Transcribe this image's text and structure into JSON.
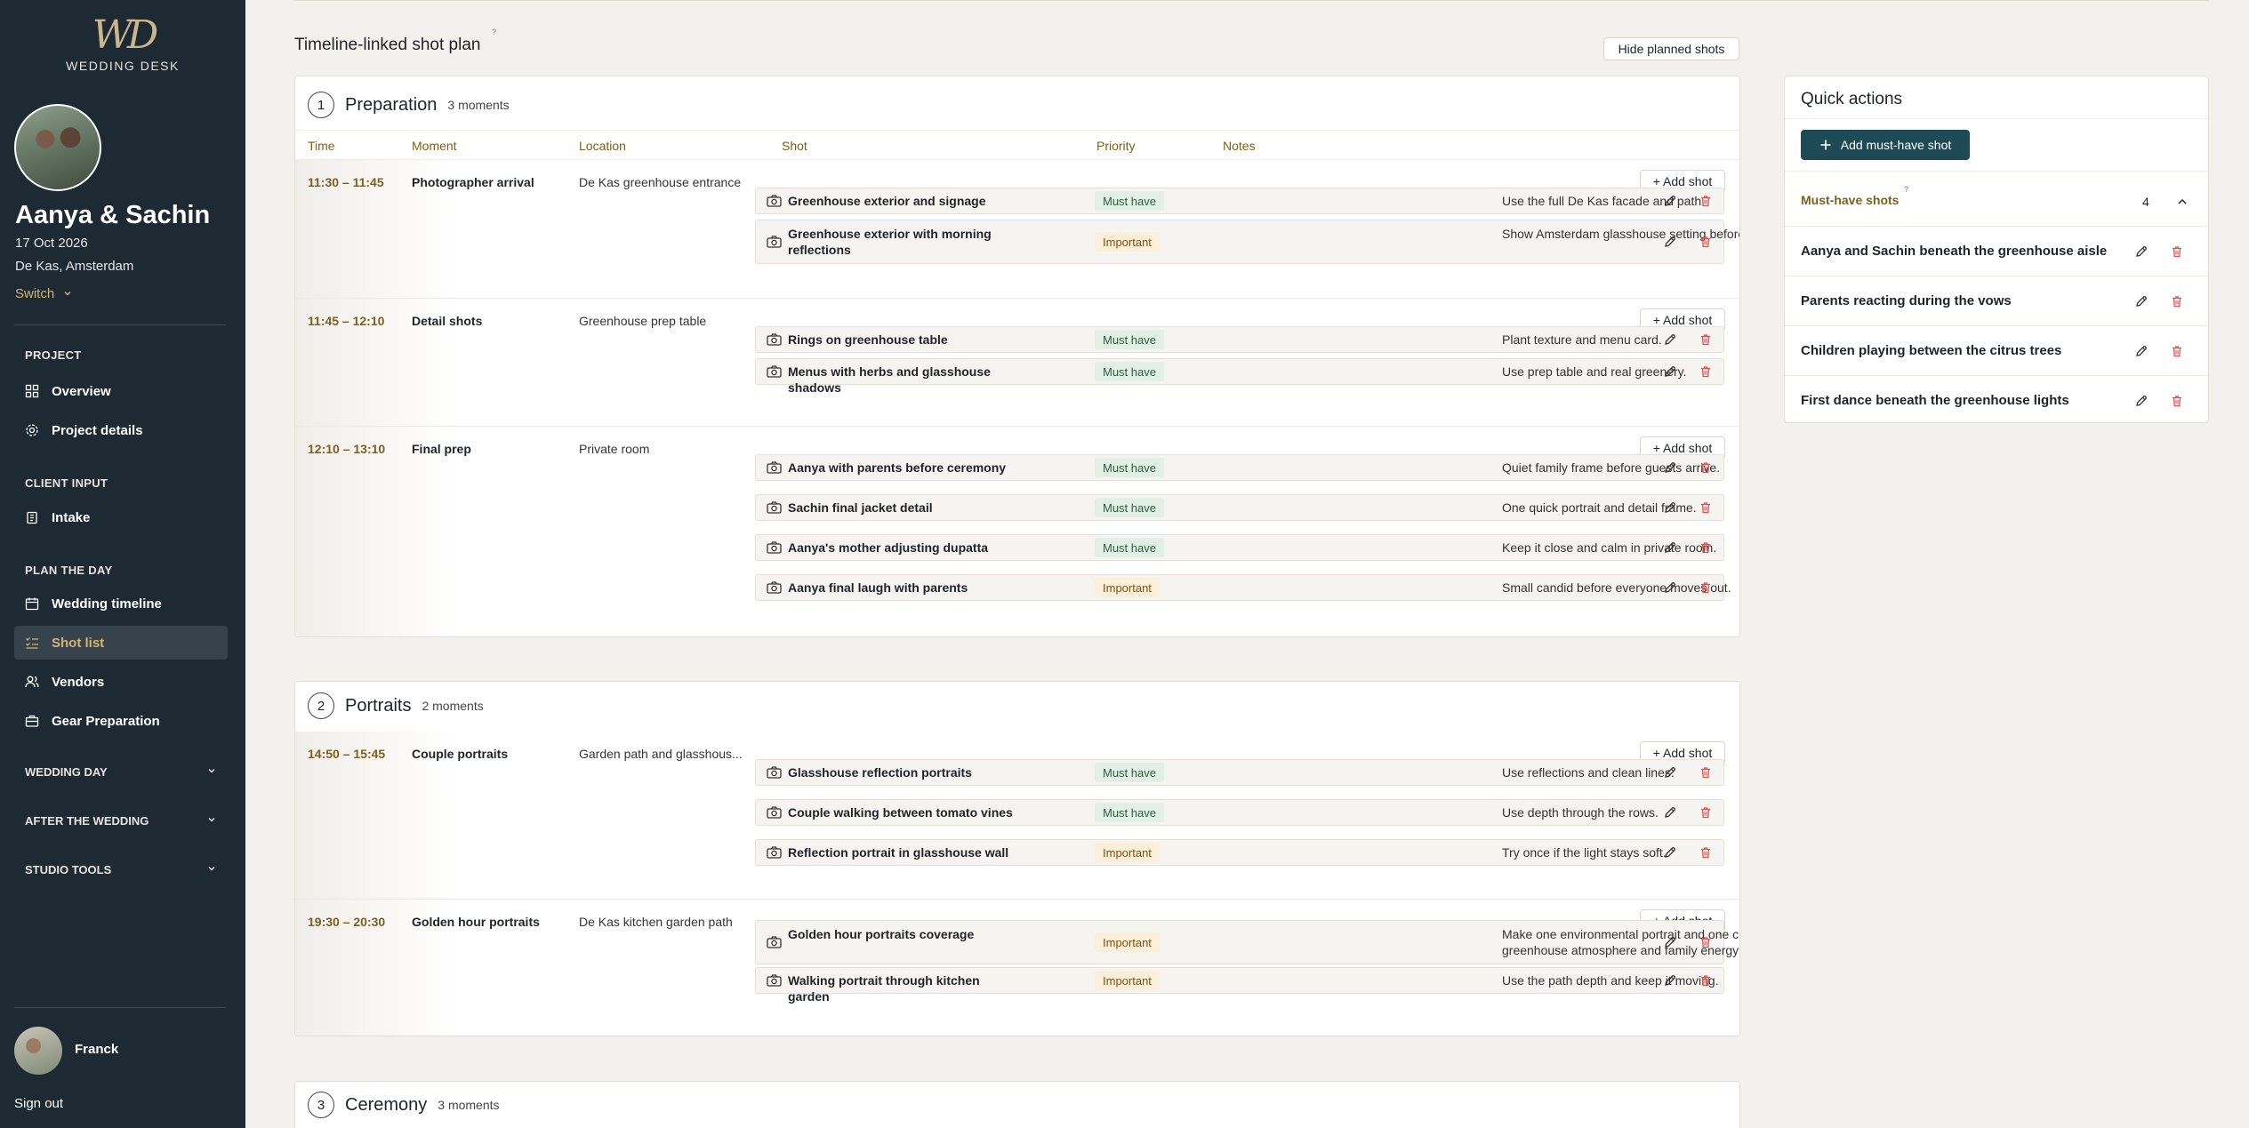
{
  "brand": {
    "logo_mark": "WD",
    "name": "WEDDING DESK"
  },
  "couple": {
    "name": "Aanya & Sachin",
    "date": "17 Oct 2026",
    "venue": "De Kas, Amsterdam",
    "switch_label": "Switch"
  },
  "nav": {
    "project_label": "PROJECT",
    "overview": "Overview",
    "project_details": "Project details",
    "client_input_label": "CLIENT INPUT",
    "intake": "Intake",
    "plan_label": "PLAN THE DAY",
    "wedding_timeline": "Wedding timeline",
    "shot_list": "Shot list",
    "vendors": "Vendors",
    "gear": "Gear Preparation",
    "wedding_day": "WEDDING DAY",
    "after_wedding": "AFTER THE WEDDING",
    "studio_tools": "STUDIO TOOLS"
  },
  "user": {
    "name": "Franck",
    "sign_out": "Sign out"
  },
  "main": {
    "title": "Timeline-linked shot plan",
    "help": "?",
    "hide_btn": "Hide planned shots",
    "add_shot": "+ Add shot"
  },
  "columns": {
    "time": "Time",
    "moment": "Moment",
    "location": "Location",
    "shot": "Shot",
    "priority": "Priority",
    "notes": "Notes"
  },
  "sections": [
    {
      "num": "1",
      "title": "Preparation",
      "count": "3 moments",
      "moments": [
        {
          "time": "11:30 – 11:45",
          "name": "Photographer arrival",
          "location": "De Kas greenhouse entrance",
          "shots": [
            {
              "title": "Greenhouse exterior and signage",
              "priority": "Must have",
              "note": "Use the full De Kas facade and path."
            },
            {
              "title": "Greenhouse exterior with morning reflections",
              "priority": "Important",
              "note": "Show Amsterdam glasshouse setting before guests arrive."
            }
          ]
        },
        {
          "time": "11:45 – 12:10",
          "name": "Detail shots",
          "location": "Greenhouse prep table",
          "shots": [
            {
              "title": "Rings on greenhouse table",
              "priority": "Must have",
              "note": "Plant texture and menu card."
            },
            {
              "title": "Menus with herbs and glasshouse shadows",
              "priority": "Must have",
              "note": "Use prep table and real greenery."
            }
          ]
        },
        {
          "time": "12:10 – 13:10",
          "name": "Final prep",
          "location": "Private room",
          "shots": [
            {
              "title": "Aanya with parents before ceremony",
              "priority": "Must have",
              "note": "Quiet family frame before guests arrive."
            },
            {
              "title": "Sachin final jacket detail",
              "priority": "Must have",
              "note": "One quick portrait and detail frame."
            },
            {
              "title": "Aanya's mother adjusting dupatta",
              "priority": "Must have",
              "note": "Keep it close and calm in private room."
            },
            {
              "title": "Aanya final laugh with parents",
              "priority": "Important",
              "note": "Small candid before everyone moves out."
            }
          ]
        }
      ]
    },
    {
      "num": "2",
      "title": "Portraits",
      "count": "2 moments",
      "moments": [
        {
          "time": "14:50 – 15:45",
          "name": "Couple portraits",
          "location": "Garden path and glasshous...",
          "shots": [
            {
              "title": "Glasshouse reflection portraits",
              "priority": "Must have",
              "note": "Use reflections and clean lines."
            },
            {
              "title": "Couple walking between tomato vines",
              "priority": "Must have",
              "note": "Use depth through the rows."
            },
            {
              "title": "Reflection portrait in glasshouse wall",
              "priority": "Important",
              "note": "Try once if the light stays soft."
            }
          ]
        },
        {
          "time": "19:30 – 20:30",
          "name": "Golden hour portraits",
          "location": "De Kas kitchen garden path",
          "shots": [
            {
              "title": "Golden hour portraits coverage",
              "priority": "Important",
              "note": "Make one environmental portrait and one closer natural frame. Keep the greenhouse atmosphere and family energy visible."
            },
            {
              "title": "Walking portrait through kitchen garden",
              "priority": "Important",
              "note": "Use the path depth and keep it moving."
            }
          ]
        }
      ]
    },
    {
      "num": "3",
      "title": "Ceremony",
      "count": "3 moments",
      "moments": []
    }
  ],
  "quick_actions": {
    "title": "Quick actions",
    "add_btn": "Add must-have shot",
    "must_have_label": "Must-have shots",
    "must_have_count": "4",
    "items": [
      "Aanya and Sachin beneath the greenhouse aisle",
      "Parents reacting during the vows",
      "Children playing between the citrus trees",
      "First dance beneath the greenhouse lights"
    ]
  },
  "colors": {
    "sidebar": "#1e2a33",
    "accent_gold": "#d4b46e",
    "primary_btn": "#1d4a55",
    "must_bg": "#e2efe6",
    "important_bg": "#fbefd9",
    "delete_red": "#d9534f"
  }
}
